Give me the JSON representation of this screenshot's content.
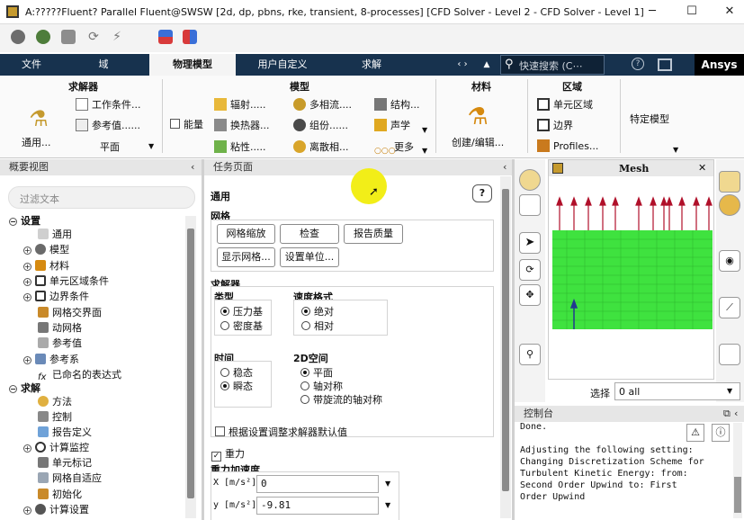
{
  "window": {
    "title": "A:?????Fluent? Parallel Fluent@SWSW  [2d, dp, pbns, rke, transient, 8-processes] [CFD Solver - Level 2 - CFD Solver - Level 1]",
    "minimize": "─",
    "maximize": "☐",
    "close": "✕"
  },
  "tabs": [
    "文件",
    "域",
    "物理模型",
    "用户自定义",
    "求解"
  ],
  "tabbar": {
    "arrows": "‹ ›",
    "caret": "▲",
    "search_placeholder": "快速搜索 (C⋯",
    "help": "?",
    "brand": "Ansys"
  },
  "ribbon": {
    "solver": {
      "title": "求解器",
      "general": "通用...",
      "operating": "工作条件...",
      "reference": "参考值......",
      "plane": "平面"
    },
    "energy": "能量",
    "models": {
      "title": "模型",
      "items": [
        "辐射.....",
        "换热器...",
        "粘性.....",
        "多相流....",
        "组份......",
        "离散相...",
        "结构...",
        "声学",
        "更多"
      ]
    },
    "materials": {
      "title": "材料",
      "create": "创建/编辑..."
    },
    "zones": {
      "title": "区域",
      "cell_zones": "单元区域",
      "boundaries": "边界",
      "profiles": "Profiles..."
    },
    "specific": "特定模型"
  },
  "outline": {
    "title": "概要视图",
    "filter_placeholder": "过滤文本",
    "setup": "设置",
    "setup_items": [
      "通用",
      "模型",
      "材料",
      "单元区域条件",
      "边界条件",
      "网格交界面",
      "动网格",
      "参考值",
      "参考系",
      "已命名的表达式"
    ],
    "solution": "求解",
    "solution_items": [
      "方法",
      "控制",
      "报告定义",
      "计算监控",
      "单元标记",
      "网格自适应",
      "初始化",
      "计算设置"
    ]
  },
  "task": {
    "title": "任务页面",
    "heading": "通用",
    "help": "?",
    "mesh": {
      "title": "网格",
      "scale": "网格缩放",
      "check": "检查",
      "report_quality": "报告质量",
      "display": "显示网格...",
      "units": "设置单位..."
    },
    "solver": {
      "title": "求解器",
      "type_label": "类型",
      "types": [
        "压力基",
        "密度基"
      ],
      "velocity_label": "速度格式",
      "velocity_opts": [
        "绝对",
        "相对"
      ],
      "time_label": "时间",
      "time_opts": [
        "稳态",
        "瞬态"
      ],
      "space_label": "2D空间",
      "space_opts": [
        "平面",
        "轴对称",
        "带旋流的轴对称"
      ]
    },
    "adjust_defaults": "根据设置调整求解器默认值",
    "gravity": "重力",
    "gravity_acc": "重力加速度",
    "gx_label": "X [m/s²]",
    "gx": "0",
    "gy_label": "y [m/s²]",
    "gy": "-9.81"
  },
  "graphics": {
    "title": "Mesh",
    "close": "✕",
    "select_label": "选择",
    "select_value": "0 all"
  },
  "console": {
    "title": "控制台",
    "lines": [
      "Done.",
      "",
      "Adjusting the following setting:",
      "Changing Discretization Scheme for",
      "Turbulent Kinetic Energy:   from:",
      "Second Order Upwind    to: First",
      "Order Upwind"
    ]
  },
  "colors": {
    "tab_bg": "#17324e",
    "mesh_green": "#3fe23f",
    "arrow_red": "#b0102a",
    "brand_bg": "#000000"
  }
}
